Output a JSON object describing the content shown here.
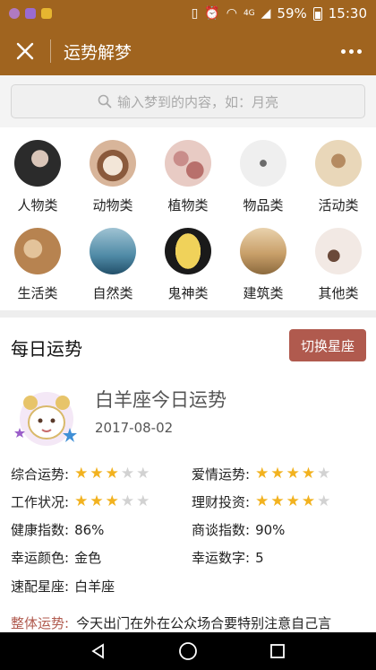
{
  "status_bar": {
    "signal": "4G",
    "battery": "59%",
    "time": "15:30"
  },
  "nav": {
    "title": "运势解梦"
  },
  "search": {
    "placeholder": "输入梦到的内容，如：月亮"
  },
  "categories": [
    {
      "label": "人物类",
      "icon": "person-thumb"
    },
    {
      "label": "动物类",
      "icon": "animal-thumb"
    },
    {
      "label": "植物类",
      "icon": "plant-thumb"
    },
    {
      "label": "物品类",
      "icon": "item-thumb"
    },
    {
      "label": "活动类",
      "icon": "activity-thumb"
    },
    {
      "label": "生活类",
      "icon": "life-thumb"
    },
    {
      "label": "自然类",
      "icon": "nature-thumb"
    },
    {
      "label": "鬼神类",
      "icon": "ghost-thumb"
    },
    {
      "label": "建筑类",
      "icon": "building-thumb"
    },
    {
      "label": "其他类",
      "icon": "other-thumb"
    }
  ],
  "daily": {
    "title": "每日运势",
    "switch_label": "切换星座",
    "sign_name": "白羊座今日运势",
    "date": "2017-08-02",
    "rows": {
      "overall": {
        "label": "综合运势:",
        "stars": 3,
        "max": 5
      },
      "love": {
        "label": "爱情运势:",
        "stars": 4,
        "max": 5
      },
      "work": {
        "label": "工作状况:",
        "stars": 3,
        "max": 5
      },
      "finance": {
        "label": "理财投资:",
        "stars": 4,
        "max": 5
      },
      "health": {
        "label": "健康指数:",
        "value": "86%"
      },
      "negotiation": {
        "label": "商谈指数:",
        "value": "90%"
      },
      "lucky_color": {
        "label": "幸运颜色:",
        "value": "金色"
      },
      "lucky_number": {
        "label": "幸运数字:",
        "value": "5"
      },
      "match_sign": {
        "label": "速配星座:",
        "value": "白羊座"
      }
    },
    "summary_label": "整体运势:",
    "summary_text": "今天出门在外在公众场合要特别注意自己言"
  },
  "colors": {
    "brand": "#a0641f",
    "accent": "#b05a4e",
    "star_on": "#f2b21f",
    "star_off": "#d2d2d2"
  }
}
